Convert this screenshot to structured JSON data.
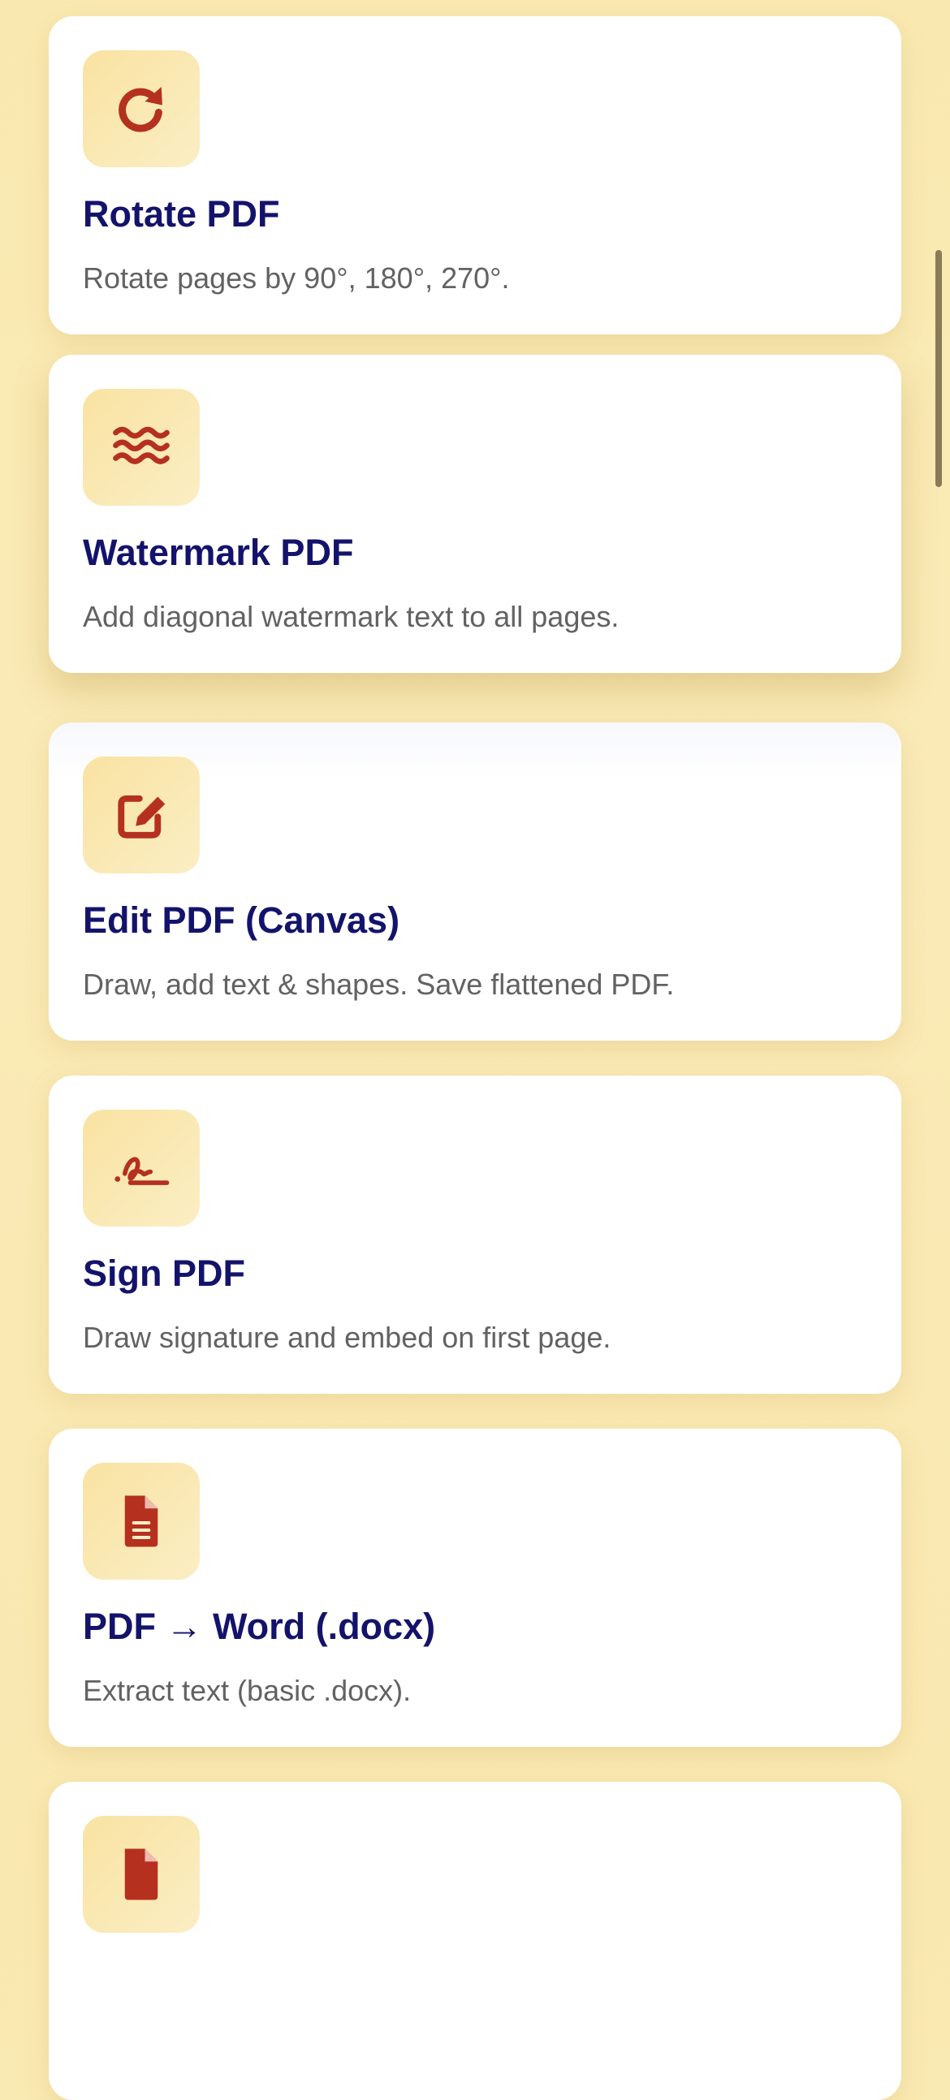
{
  "colors": {
    "background": "#faeab6",
    "card": "#ffffff",
    "icon_bg": "#f9e3a2",
    "icon": "#b5301f",
    "title": "#14136b",
    "description": "#626262"
  },
  "tools": [
    {
      "icon": "rotate-icon",
      "title": "Rotate PDF",
      "description": "Rotate pages by 90°, 180°, 270°."
    },
    {
      "icon": "water-waves-icon",
      "title": "Watermark PDF",
      "description": "Add diagonal watermark text to all pages."
    },
    {
      "icon": "edit-pen-icon",
      "title": "Edit PDF (Canvas)",
      "description": "Draw, add text & shapes. Save flattened PDF."
    },
    {
      "icon": "signature-icon",
      "title": "Sign PDF",
      "description": "Draw signature and embed on first page."
    },
    {
      "icon": "document-icon",
      "title": "PDF → Word (.docx)",
      "description": "Extract text (basic .docx)."
    },
    {
      "icon": "document-icon",
      "title": "",
      "description": ""
    }
  ]
}
